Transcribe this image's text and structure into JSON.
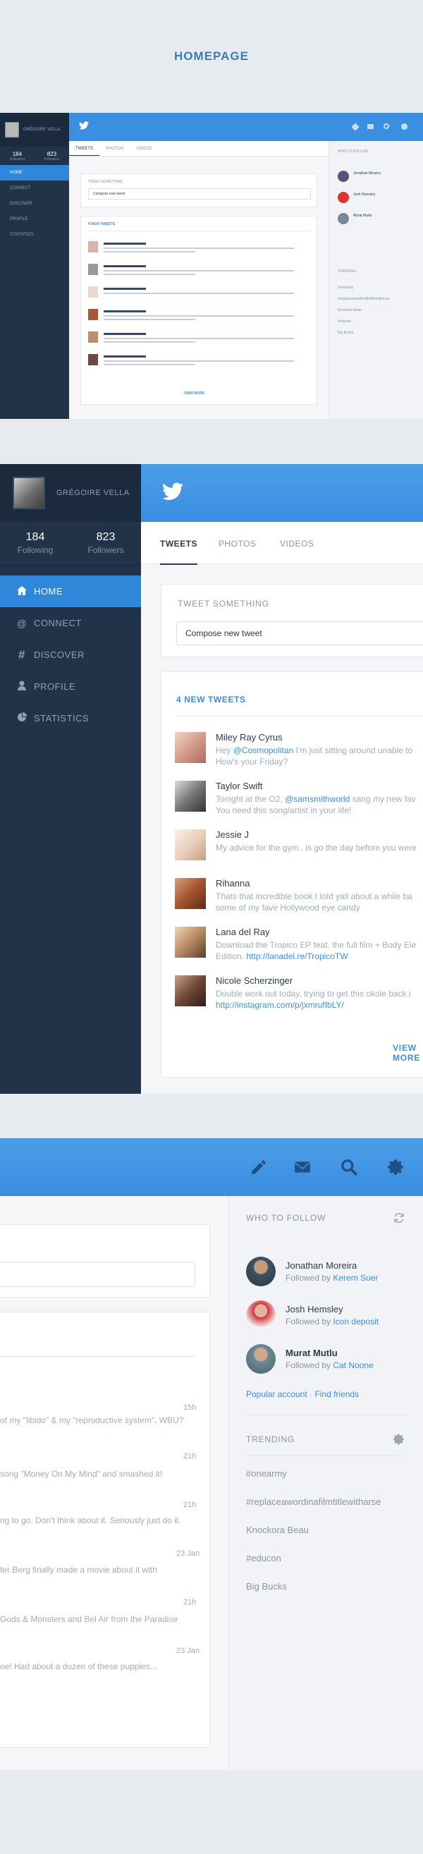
{
  "page": {
    "title": "HOMEPAGE"
  },
  "profile": {
    "name": "GRÉGOIRE VELLA",
    "following_count": "184",
    "following_label": "Following",
    "followers_count": "823",
    "followers_label": "Followers"
  },
  "nav": [
    {
      "label": "HOME",
      "icon": "home-icon"
    },
    {
      "label": "CONNECT",
      "icon": "at-icon"
    },
    {
      "label": "DISCOVER",
      "icon": "hashtag-icon"
    },
    {
      "label": "PROFILE",
      "icon": "user-icon"
    },
    {
      "label": "STATISTICS",
      "icon": "pie-chart-icon"
    }
  ],
  "tabs": [
    "TWEETS",
    "PHOTOS",
    "VIDEOS"
  ],
  "compose": {
    "label": "TWEET SOMETHING",
    "placeholder": "Compose new tweet"
  },
  "feed": {
    "header": "4 NEW TWEETS",
    "view_more": "VIEW MORE",
    "tweets": [
      {
        "name": "Miley Ray Cyrus",
        "pre": "Hey ",
        "mention": "@Cosmopolitan",
        "post": " I'm just sitting around unable to",
        "line2": "How's your Friday?",
        "time": "15h"
      },
      {
        "name": "Taylor Swift",
        "pre": "Tonight at the O2, ",
        "mention": "@samsmithworld",
        "post": " sang my new fav",
        "line2": "You need this song/artist in your life!",
        "time": "21h"
      },
      {
        "name": "Jessie J",
        "pre": "My advice for the gym.. is go the day before you were",
        "mention": "",
        "post": "",
        "line2": "",
        "time": "21h"
      },
      {
        "name": "Rihanna",
        "pre": "Thats that incredible book I told yall about a while ba",
        "mention": "",
        "post": "",
        "line2": "some of my fave Hollywood eye candy",
        "time": "23 Jan"
      },
      {
        "name": "Lana del Ray",
        "pre": "Download the Tropico EP feat. the full film + Body Ele",
        "mention": "",
        "post": "",
        "line2_pre": "Edition. ",
        "link": "http://lanadel.re/TropicoTW",
        "time": "21h"
      },
      {
        "name": "Nicole Scherzinger",
        "pre": "Double work out today, trying to get this okole back i",
        "mention": "",
        "post": "",
        "link_only": "http://instagram.com/p/jxmrufIbLY/",
        "time": "23 Jan"
      }
    ]
  },
  "right_fragments": [
    "of my \"libido\" & my \"reproductive system\". WBU?",
    "song \"Money On My Mind\" and smashed it!",
    "ng to go. Don't think about it. Seriously just do it.",
    "ter Berg finally made a movie about it with",
    "Gods & Monsters and Bel Air from the Paradise",
    "oe! Had about a dozen of these puppies..."
  ],
  "who_to_follow": {
    "header": "WHO TO FOLLOW",
    "people": [
      {
        "name": "Jonathan Moreira",
        "by": "Followed by ",
        "via": "Kerem Suer"
      },
      {
        "name": "Josh Hemsley",
        "by": "Followed by ",
        "via": "Icon deposit"
      },
      {
        "name": "Murat Mutlu",
        "by": "Followed by ",
        "via": "Cat Noone"
      }
    ],
    "popular": "Popular account",
    "sep": " · ",
    "find": "Find friends"
  },
  "trending": {
    "header": "TRENDING",
    "items": [
      "#onearmy",
      "#replaceawordinafilmtitlewitharse",
      "Knockora Beau",
      "#educon",
      "Big Bucks"
    ]
  },
  "colors": {
    "accent": "#3b8fe0",
    "sidebar": "#223249",
    "topbar": "#3b8fe0"
  }
}
